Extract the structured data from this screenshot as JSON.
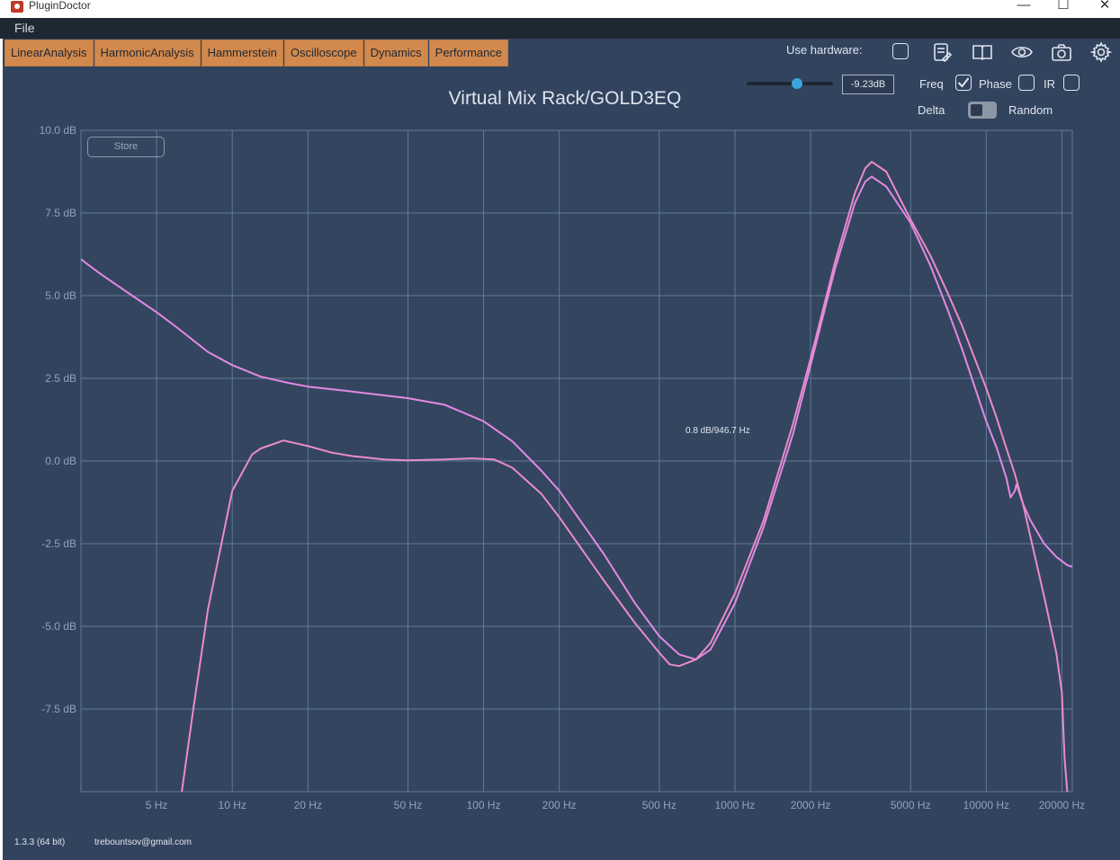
{
  "window": {
    "title": "PluginDoctor",
    "minimize": "—",
    "maximize": "☐",
    "close": "✕"
  },
  "menu": {
    "file": "File"
  },
  "tabs": [
    {
      "label": "LinearAnalysis"
    },
    {
      "label": "HarmonicAnalysis"
    },
    {
      "label": "Hammerstein"
    },
    {
      "label": "Oscilloscope"
    },
    {
      "label": "Dynamics"
    },
    {
      "label": "Performance"
    }
  ],
  "toolbar": {
    "use_hardware_label": "Use hardware:",
    "icons": [
      "notes-icon",
      "book-icon",
      "eye-icon",
      "camera-icon",
      "gear-icon"
    ]
  },
  "plot": {
    "title": "Virtual Mix Rack/GOLD3EQ",
    "gain_value": "-9.23dB",
    "slider_level": 0.58,
    "store_label": "Store",
    "cursor_readout": "0.8 dB/946.7 Hz"
  },
  "options": {
    "freq_label": "Freq",
    "freq_checked": true,
    "phase_label": "Phase",
    "phase_checked": false,
    "ir_label": "IR",
    "ir_checked": false,
    "delta_label": "Delta",
    "random_label": "Random"
  },
  "chart_data": {
    "type": "line",
    "y_ticks": [
      "10.0 dB",
      "7.5 dB",
      "5.0 dB",
      "2.5 dB",
      "0.0 dB",
      "-2.5 dB",
      "-5.0 dB",
      "-7.5 dB"
    ],
    "y_values": [
      10,
      7.5,
      5,
      2.5,
      0,
      -2.5,
      -5,
      -7.5
    ],
    "x_ticks": [
      "5 Hz",
      "10 Hz",
      "20 Hz",
      "50 Hz",
      "100 Hz",
      "200 Hz",
      "500 Hz",
      "1000 Hz",
      "2000 Hz",
      "5000 Hz",
      "10000 Hz",
      "20000 Hz"
    ],
    "x_values": [
      5,
      10,
      20,
      50,
      100,
      200,
      500,
      1000,
      2000,
      5000,
      10000,
      20000
    ],
    "x_scale": "log",
    "xlim": [
      2.5,
      22000
    ],
    "ylim": [
      -10,
      10
    ],
    "grid": true,
    "series": [
      {
        "color": "#e389e3",
        "points": [
          [
            2.5,
            6.1
          ],
          [
            3,
            5.65
          ],
          [
            4,
            5.0
          ],
          [
            5,
            4.5
          ],
          [
            6,
            4.05
          ],
          [
            8,
            3.3
          ],
          [
            10,
            2.9
          ],
          [
            13,
            2.55
          ],
          [
            17,
            2.35
          ],
          [
            20,
            2.25
          ],
          [
            30,
            2.1
          ],
          [
            50,
            1.9
          ],
          [
            70,
            1.7
          ],
          [
            100,
            1.2
          ],
          [
            130,
            0.6
          ],
          [
            170,
            -0.3
          ],
          [
            200,
            -0.9
          ],
          [
            300,
            -2.8
          ],
          [
            400,
            -4.3
          ],
          [
            500,
            -5.3
          ],
          [
            600,
            -5.85
          ],
          [
            700,
            -6.0
          ],
          [
            800,
            -5.7
          ],
          [
            1000,
            -4.3
          ],
          [
            1300,
            -2.0
          ],
          [
            1700,
            0.8
          ],
          [
            2000,
            2.9
          ],
          [
            2500,
            5.8
          ],
          [
            3000,
            7.8
          ],
          [
            3300,
            8.45
          ],
          [
            3500,
            8.6
          ],
          [
            4000,
            8.3
          ],
          [
            5000,
            7.2
          ],
          [
            6000,
            5.9
          ],
          [
            7000,
            4.6
          ],
          [
            8000,
            3.4
          ],
          [
            10000,
            1.2
          ],
          [
            11000,
            0.4
          ],
          [
            12000,
            -0.5
          ],
          [
            12500,
            -1.1
          ],
          [
            13000,
            -0.9
          ],
          [
            13200,
            -0.7
          ],
          [
            14000,
            -1.3
          ],
          [
            15000,
            -1.8
          ],
          [
            17000,
            -2.5
          ],
          [
            19000,
            -2.9
          ],
          [
            21000,
            -3.15
          ],
          [
            22000,
            -3.2
          ]
        ]
      },
      {
        "color": "#ea8cc9",
        "points": [
          [
            6.3,
            -10
          ],
          [
            7,
            -7.5
          ],
          [
            8,
            -4.5
          ],
          [
            10,
            -0.9
          ],
          [
            12,
            0.2
          ],
          [
            13,
            0.38
          ],
          [
            16,
            0.62
          ],
          [
            20,
            0.45
          ],
          [
            25,
            0.25
          ],
          [
            30,
            0.15
          ],
          [
            40,
            0.05
          ],
          [
            50,
            0.02
          ],
          [
            70,
            0.05
          ],
          [
            90,
            0.08
          ],
          [
            110,
            0.05
          ],
          [
            130,
            -0.2
          ],
          [
            170,
            -1.0
          ],
          [
            200,
            -1.7
          ],
          [
            300,
            -3.6
          ],
          [
            400,
            -4.9
          ],
          [
            500,
            -5.8
          ],
          [
            550,
            -6.15
          ],
          [
            600,
            -6.2
          ],
          [
            700,
            -6.0
          ],
          [
            800,
            -5.5
          ],
          [
            1000,
            -4.0
          ],
          [
            1300,
            -1.8
          ],
          [
            1700,
            1.1
          ],
          [
            2000,
            3.1
          ],
          [
            2500,
            6.0
          ],
          [
            3000,
            8.1
          ],
          [
            3300,
            8.85
          ],
          [
            3500,
            9.05
          ],
          [
            4000,
            8.75
          ],
          [
            5000,
            7.3
          ],
          [
            6000,
            6.2
          ],
          [
            7000,
            5.1
          ],
          [
            8000,
            4.1
          ],
          [
            10000,
            2.2
          ],
          [
            11000,
            1.3
          ],
          [
            12000,
            0.4
          ],
          [
            13000,
            -0.4
          ],
          [
            14000,
            -1.3
          ],
          [
            15000,
            -2.3
          ],
          [
            17000,
            -4.1
          ],
          [
            19000,
            -5.8
          ],
          [
            20000,
            -7.0
          ],
          [
            20500,
            -9.0
          ],
          [
            21000,
            -10
          ]
        ]
      }
    ]
  },
  "footer": {
    "version": "1.3.3 (64 bit)",
    "email": "trebountsov@gmail.com"
  }
}
